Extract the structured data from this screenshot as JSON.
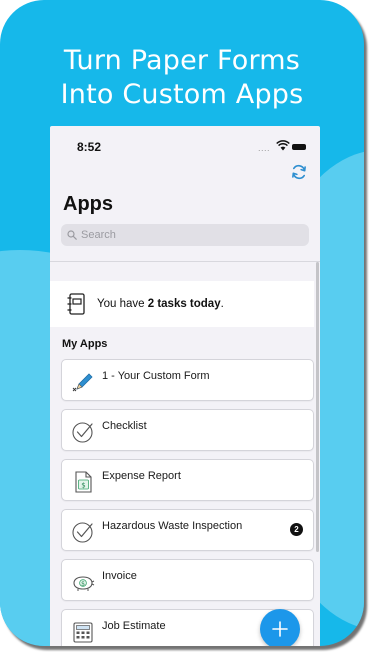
{
  "promo": {
    "headline_line1": "Turn Paper Forms",
    "headline_line2": "Into Custom Apps"
  },
  "status_bar": {
    "time": "8:52",
    "signal": "....",
    "wifi_icon": "wifi-icon",
    "battery_icon": "battery-icon"
  },
  "header": {
    "title": "Apps",
    "refresh_icon": "refresh-icon"
  },
  "search": {
    "placeholder": "Search",
    "value": ""
  },
  "tasks": {
    "prefix": "You have ",
    "count_text": "2 tasks today",
    "suffix": "."
  },
  "my_apps": {
    "section_title": "My Apps",
    "items": [
      {
        "label": "1 - Your Custom Form",
        "icon": "pencil-icon",
        "badge": ""
      },
      {
        "label": "Checklist",
        "icon": "checkmark-circle-icon",
        "badge": ""
      },
      {
        "label": "Expense Report",
        "icon": "dollar-document-icon",
        "badge": ""
      },
      {
        "label": "Hazardous Waste Inspection",
        "icon": "checkmark-circle-icon",
        "badge": "2"
      },
      {
        "label": "Invoice",
        "icon": "piggy-bank-icon",
        "badge": ""
      },
      {
        "label": "Job Estimate",
        "icon": "calculator-icon",
        "badge": ""
      }
    ]
  },
  "fab": {
    "icon": "plus-icon"
  },
  "colors": {
    "brand_blue": "#16b8ea",
    "fab_blue": "#1c97ea",
    "icon_blue": "#2e8fd0"
  }
}
